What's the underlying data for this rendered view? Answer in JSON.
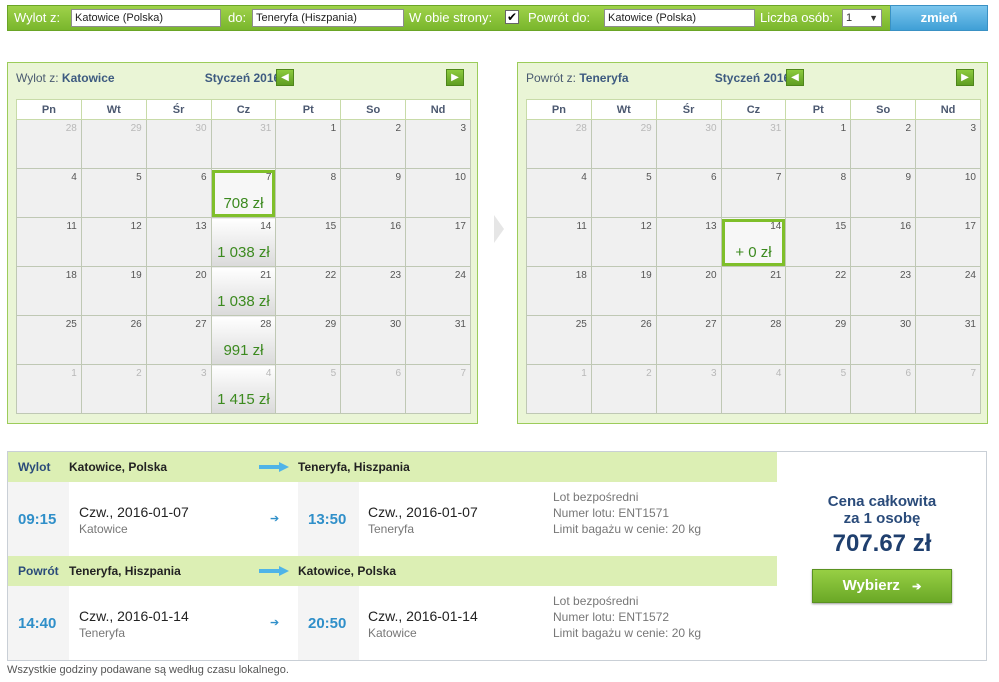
{
  "search": {
    "from_label": "Wylot z:",
    "from_value": "Katowice (Polska)",
    "to_label": "do:",
    "to_value": "Teneryfa (Hiszpania)",
    "roundtrip_label": "W obie strony:",
    "roundtrip_checked": "✔",
    "return_label": "Powrót do:",
    "return_value": "Katowice (Polska)",
    "persons_label": "Liczba osób:",
    "persons_value": "1",
    "change_button": "zmień"
  },
  "weekdays": [
    "Pn",
    "Wt",
    "Śr",
    "Cz",
    "Pt",
    "So",
    "Nd"
  ],
  "outbound_calendar": {
    "title_prefix": "Wylot z:",
    "title_city": "Katowice",
    "month": "Styczeń 2016",
    "rows": [
      [
        {
          "d": "28",
          "m": true
        },
        {
          "d": "29",
          "m": true
        },
        {
          "d": "30",
          "m": true
        },
        {
          "d": "31",
          "m": true
        },
        {
          "d": "1"
        },
        {
          "d": "2"
        },
        {
          "d": "3"
        }
      ],
      [
        {
          "d": "4"
        },
        {
          "d": "5"
        },
        {
          "d": "6"
        },
        {
          "d": "7",
          "p": "708 zł",
          "sel": true
        },
        {
          "d": "8"
        },
        {
          "d": "9"
        },
        {
          "d": "10"
        }
      ],
      [
        {
          "d": "11"
        },
        {
          "d": "12"
        },
        {
          "d": "13"
        },
        {
          "d": "14",
          "p": "1 038 zł"
        },
        {
          "d": "15"
        },
        {
          "d": "16"
        },
        {
          "d": "17"
        }
      ],
      [
        {
          "d": "18"
        },
        {
          "d": "19"
        },
        {
          "d": "20"
        },
        {
          "d": "21",
          "p": "1 038 zł"
        },
        {
          "d": "22"
        },
        {
          "d": "23"
        },
        {
          "d": "24"
        }
      ],
      [
        {
          "d": "25"
        },
        {
          "d": "26"
        },
        {
          "d": "27"
        },
        {
          "d": "28",
          "p": "991 zł"
        },
        {
          "d": "29"
        },
        {
          "d": "30"
        },
        {
          "d": "31"
        }
      ],
      [
        {
          "d": "1",
          "m": true
        },
        {
          "d": "2",
          "m": true
        },
        {
          "d": "3",
          "m": true
        },
        {
          "d": "4",
          "m": true,
          "p": "1 415 zł"
        },
        {
          "d": "5",
          "m": true
        },
        {
          "d": "6",
          "m": true
        },
        {
          "d": "7",
          "m": true
        }
      ]
    ]
  },
  "return_calendar": {
    "title_prefix": "Powrót z:",
    "title_city": "Teneryfa",
    "month": "Styczeń 2016",
    "rows": [
      [
        {
          "d": "28",
          "m": true
        },
        {
          "d": "29",
          "m": true
        },
        {
          "d": "30",
          "m": true
        },
        {
          "d": "31",
          "m": true
        },
        {
          "d": "1"
        },
        {
          "d": "2"
        },
        {
          "d": "3"
        }
      ],
      [
        {
          "d": "4"
        },
        {
          "d": "5"
        },
        {
          "d": "6"
        },
        {
          "d": "7"
        },
        {
          "d": "8"
        },
        {
          "d": "9"
        },
        {
          "d": "10"
        }
      ],
      [
        {
          "d": "11"
        },
        {
          "d": "12"
        },
        {
          "d": "13"
        },
        {
          "d": "14",
          "p": "+ 0 zł",
          "sel": true
        },
        {
          "d": "15"
        },
        {
          "d": "16"
        },
        {
          "d": "17"
        }
      ],
      [
        {
          "d": "18"
        },
        {
          "d": "19"
        },
        {
          "d": "20"
        },
        {
          "d": "21"
        },
        {
          "d": "22"
        },
        {
          "d": "23"
        },
        {
          "d": "24"
        }
      ],
      [
        {
          "d": "25"
        },
        {
          "d": "26"
        },
        {
          "d": "27"
        },
        {
          "d": "28"
        },
        {
          "d": "29"
        },
        {
          "d": "30"
        },
        {
          "d": "31"
        }
      ],
      [
        {
          "d": "1",
          "m": true
        },
        {
          "d": "2",
          "m": true
        },
        {
          "d": "3",
          "m": true
        },
        {
          "d": "4",
          "m": true
        },
        {
          "d": "5",
          "m": true
        },
        {
          "d": "6",
          "m": true
        },
        {
          "d": "7",
          "m": true
        }
      ]
    ]
  },
  "outbound_leg": {
    "tag": "Wylot",
    "from": "Katowice, Polska",
    "to": "Teneryfa, Hiszpania",
    "dep_time": "09:15",
    "dep_date": "Czw., 2016-01-07",
    "dep_city": "Katowice",
    "arr_time": "13:50",
    "arr_date": "Czw., 2016-01-07",
    "arr_city": "Teneryfa",
    "type": "Lot bezpośredni",
    "flight_no": "Numer lotu: ENT1571",
    "baggage": "Limit bagażu w cenie: 20 kg"
  },
  "return_leg": {
    "tag": "Powrót",
    "from": "Teneryfa, Hiszpania",
    "to": "Katowice, Polska",
    "dep_time": "14:40",
    "dep_date": "Czw., 2016-01-14",
    "dep_city": "Teneryfa",
    "arr_time": "20:50",
    "arr_date": "Czw., 2016-01-14",
    "arr_city": "Katowice",
    "type": "Lot bezpośredni",
    "flight_no": "Numer lotu: ENT1572",
    "baggage": "Limit bagażu w cenie: 20 kg"
  },
  "price": {
    "label_line1": "Cena całkowita",
    "label_line2": "za 1 osobę",
    "value": "707.67 zł",
    "button": "Wybierz"
  },
  "footnote": "Wszystkie godziny podawane są według czasu lokalnego.",
  "colors": {
    "accent_green": "#7fbf2a",
    "accent_blue": "#2f8fc9",
    "price_green": "#3c8a1f"
  }
}
